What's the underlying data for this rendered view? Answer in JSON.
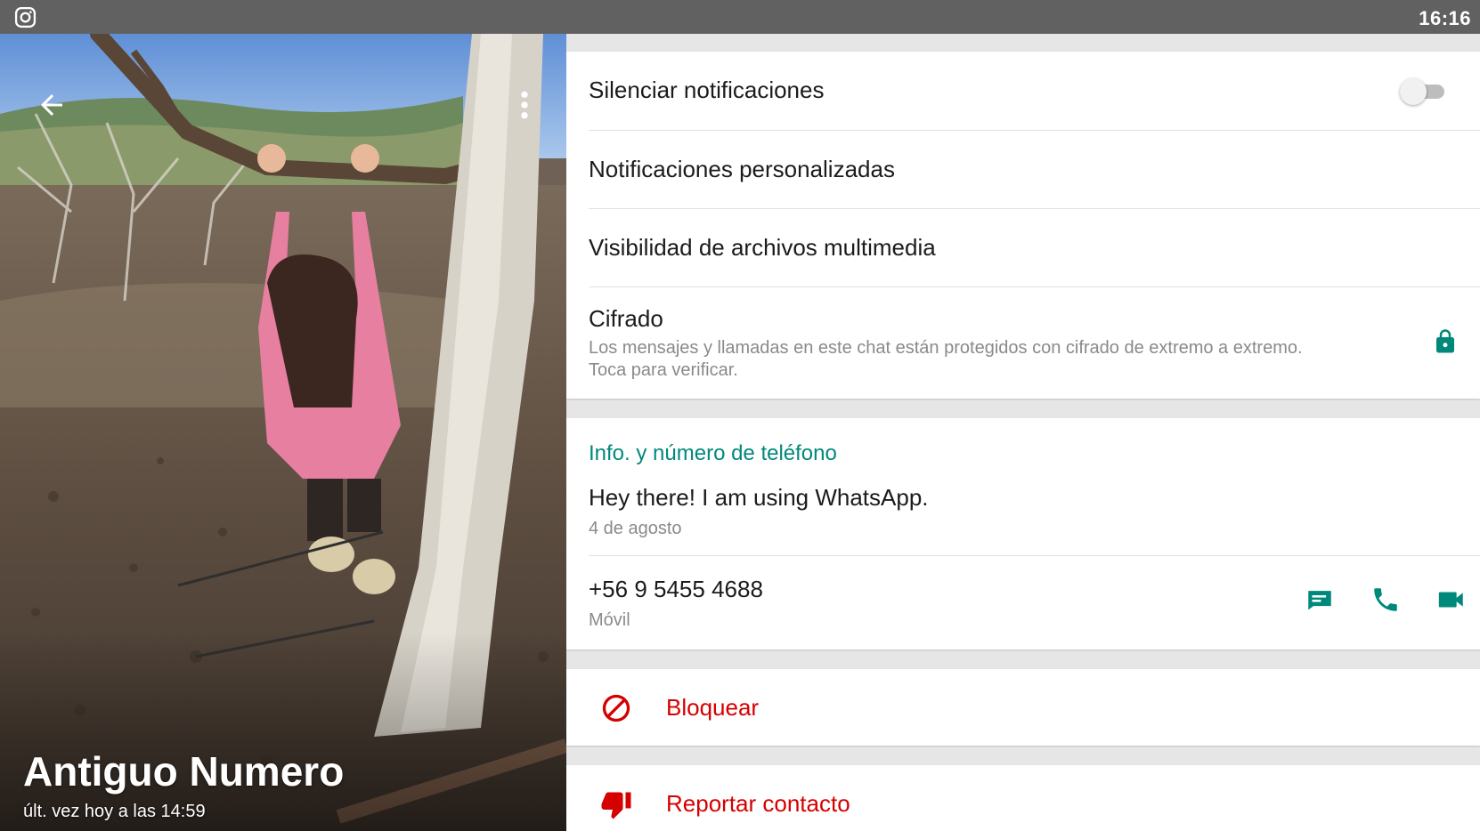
{
  "status_bar": {
    "time": "16:16",
    "app_icon": "instagram-icon"
  },
  "header": {
    "contact_name": "Antiguo Numero",
    "last_seen": "últ. vez hoy a las 14:59",
    "back_icon": "arrow-back-icon",
    "menu_icon": "more-vert-icon"
  },
  "settings": {
    "mute": {
      "label": "Silenciar notificaciones",
      "enabled": false
    },
    "custom_notifications": {
      "label": "Notificaciones personalizadas"
    },
    "media_visibility": {
      "label": "Visibilidad de archivos multimedia"
    },
    "encryption": {
      "title": "Cifrado",
      "line1": "Los mensajes y llamadas en este chat están protegidos con cifrado de extremo a extremo.",
      "line2": "Toca para verificar.",
      "icon": "lock-icon"
    }
  },
  "about": {
    "header": "Info. y número de teléfono",
    "status_text": "Hey there! I am using WhatsApp.",
    "status_date": "4 de agosto",
    "phone": "+56 9 5455 4688",
    "phone_type": "Móvil"
  },
  "actions": {
    "block": "Bloquear",
    "report": "Reportar contacto"
  },
  "colors": {
    "accent": "#00897b",
    "danger": "#d50000",
    "status_bar": "#616161"
  }
}
